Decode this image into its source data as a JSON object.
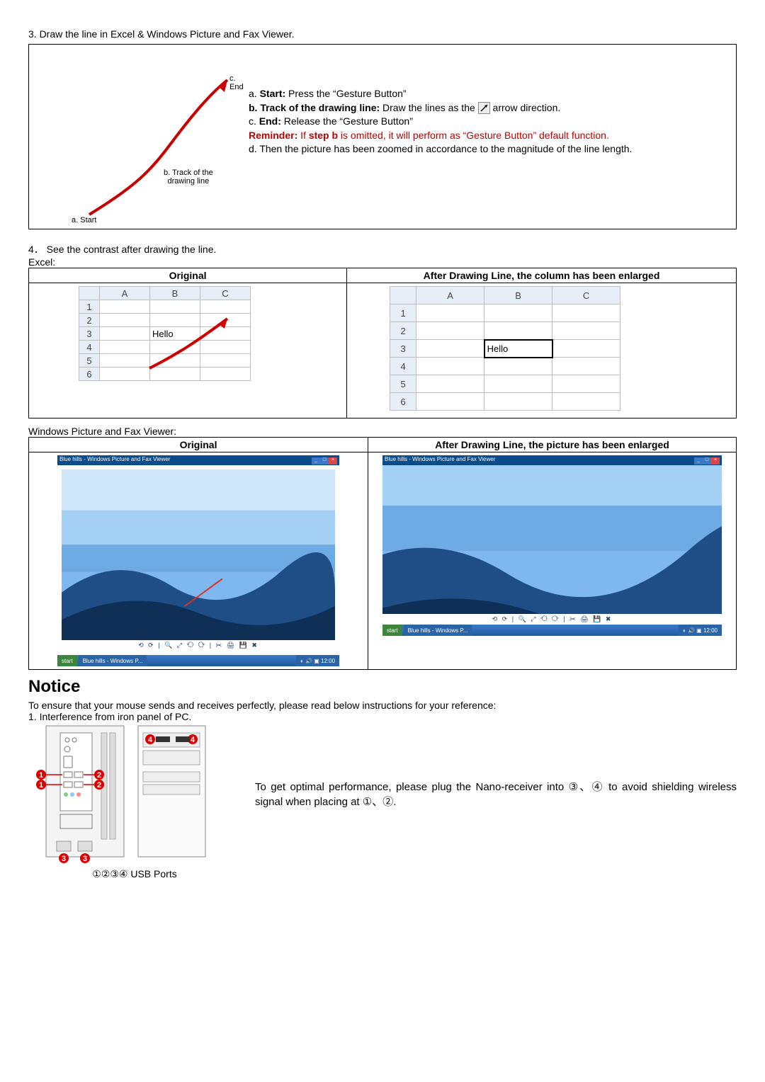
{
  "step3": {
    "heading": "3.  Draw the line in Excel & Windows Picture and Fax Viewer.",
    "diagram": {
      "label_a": "a. Start",
      "label_b": "b. Track of the\ndrawing line",
      "label_c": "c. End"
    },
    "text": {
      "a_bold": "Start:",
      "a_rest": " Press the “Gesture Button”",
      "a_prefix": "a. ",
      "b_bold": "b. Track of the drawing line:",
      "b_rest": " Draw the lines as the",
      "b_rest2": "arrow direction.",
      "c_prefix": "c. ",
      "c_bold": "End:",
      "c_rest": " Release the “Gesture Button”",
      "reminder_bold": "Reminder:",
      "reminder_rest": " If step b is omitted, it will perform as “Gesture Button” default function.",
      "reminder_mid_bold": "step b",
      "reminder_pre": " If ",
      "reminder_post": " is omitted, it will perform as “Gesture Button” default function.",
      "d": "d. Then the picture has been zoomed in accordance to the magnitude of the line length."
    }
  },
  "step4": {
    "heading": "4． See the contrast after drawing the line.",
    "excel_label": "Excel:",
    "col_original": "Original",
    "col_enlarged_excel": "After Drawing Line, the column has been enlarged",
    "excel": {
      "cols": [
        "A",
        "B",
        "C"
      ],
      "rows": [
        "1",
        "2",
        "3",
        "4",
        "5",
        "6"
      ],
      "cell_b3": "Hello"
    },
    "wpfv_label": "Windows Picture and Fax Viewer:",
    "col_enlarged_pic": "After Drawing Line, the picture has been enlarged",
    "wpfv_title": "Blue hills - Windows Picture and Fax Viewer",
    "start": "start",
    "taskbar_item": "Blue hills - Windows P..."
  },
  "notice": {
    "title": "Notice",
    "intro": "To ensure that your mouse sends and receives perfectly, please read below instructions for your reference:",
    "item1": "1. Interference from iron panel of PC.",
    "usb_label": "①②③④ USB Ports",
    "desc": "To get optimal performance, please plug the Nano-receiver into ③、④ to avoid shielding wireless signal when placing at ①、②."
  }
}
